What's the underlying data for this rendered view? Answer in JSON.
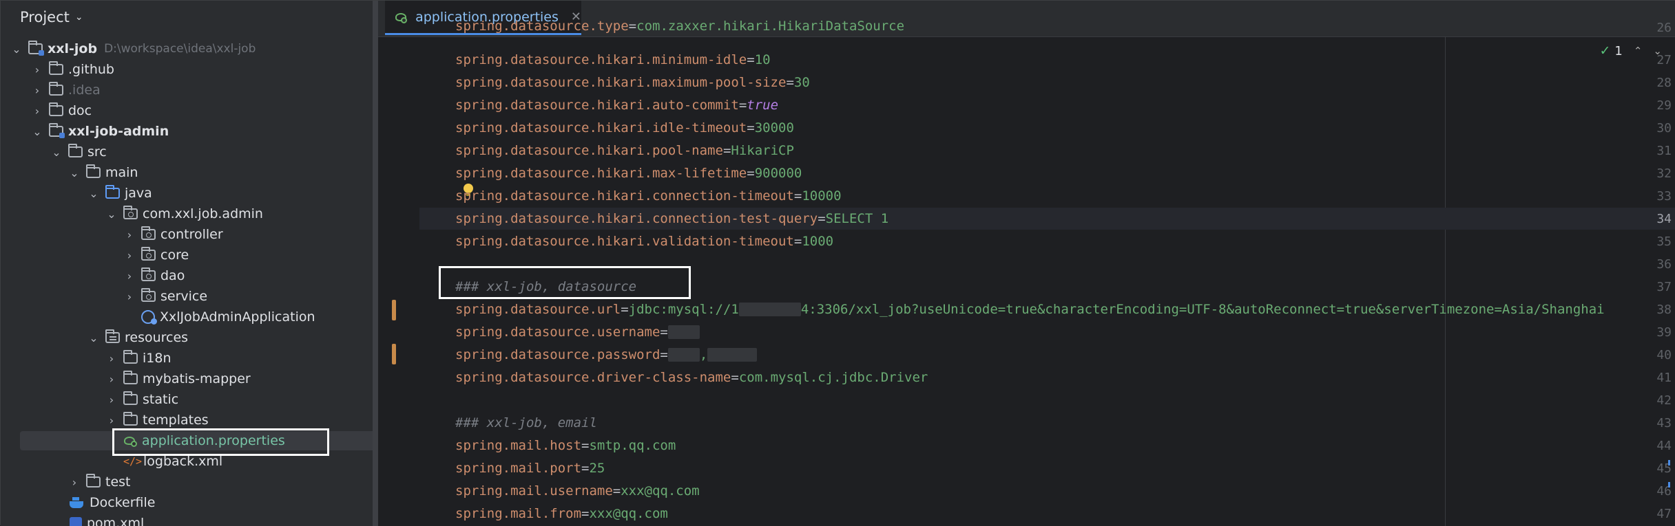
{
  "project_panel": {
    "title": "Project",
    "tree": [
      {
        "label": "xxl-job",
        "hint": "D:\\workspace\\idea\\xxl-job"
      },
      {
        "label": ".github"
      },
      {
        "label": ".idea"
      },
      {
        "label": "doc"
      },
      {
        "label": "xxl-job-admin"
      },
      {
        "label": "src"
      },
      {
        "label": "main"
      },
      {
        "label": "java"
      },
      {
        "label": "com.xxl.job.admin"
      },
      {
        "label": "controller"
      },
      {
        "label": "core"
      },
      {
        "label": "dao"
      },
      {
        "label": "service"
      },
      {
        "label": "XxlJobAdminApplication"
      },
      {
        "label": "resources"
      },
      {
        "label": "i18n"
      },
      {
        "label": "mybatis-mapper"
      },
      {
        "label": "static"
      },
      {
        "label": "templates"
      },
      {
        "label": "application.properties"
      },
      {
        "label": "logback.xml"
      },
      {
        "label": "test"
      },
      {
        "label": "Dockerfile"
      },
      {
        "label": "pom.xml"
      }
    ]
  },
  "editor": {
    "tab_label": "application.properties",
    "inspection_count": "1",
    "lines": [
      {
        "n": "26",
        "key": "spring.datasource.type",
        "eq": "=",
        "val": "com.zaxxer.hikari.HikariDataSource"
      },
      {
        "n": "27",
        "key": "spring.datasource.hikari.minimum-idle",
        "eq": "=",
        "val": "10"
      },
      {
        "n": "28",
        "key": "spring.datasource.hikari.maximum-pool-size",
        "eq": "=",
        "val": "30"
      },
      {
        "n": "29",
        "key": "spring.datasource.hikari.auto-commit",
        "eq": "=",
        "val": "true"
      },
      {
        "n": "30",
        "key": "spring.datasource.hikari.idle-timeout",
        "eq": "=",
        "val": "30000"
      },
      {
        "n": "31",
        "key": "spring.datasource.hikari.pool-name",
        "eq": "=",
        "val": "HikariCP"
      },
      {
        "n": "32",
        "key": "spring.datasource.hikari.max-lifetime",
        "eq": "=",
        "val": "900000"
      },
      {
        "n": "33",
        "key": "spring.datasource.hikari.connection-timeout",
        "eq": "=",
        "val": "10000"
      },
      {
        "n": "34",
        "key": "spring.datasource.hikari.connection-test-query",
        "eq": "=",
        "val": "SELECT 1"
      },
      {
        "n": "35",
        "key": "spring.datasource.hikari.validation-timeout",
        "eq": "=",
        "val": "1000"
      },
      {
        "n": "36"
      },
      {
        "n": "37",
        "comment": "### xxl-job, datasource"
      },
      {
        "n": "38",
        "key": "spring.datasource.url",
        "eq": "=",
        "val_a": "jdbc:mysql://1",
        "val_b": "4:3306/xxl_job?useUnicode=true&characterEncoding=UTF-8&autoReconnect=true&serverTimezone=Asia/Shanghai"
      },
      {
        "n": "39",
        "key": "spring.datasource.username",
        "eq": "="
      },
      {
        "n": "40",
        "key": "spring.datasource.password",
        "eq": "=",
        "val_a": ","
      },
      {
        "n": "41",
        "key": "spring.datasource.driver-class-name",
        "eq": "=",
        "val": "com.mysql.cj.jdbc.Driver"
      },
      {
        "n": "42"
      },
      {
        "n": "43",
        "comment": "### xxl-job, email"
      },
      {
        "n": "44",
        "key": "spring.mail.host",
        "eq": "=",
        "val": "smtp.qq.com"
      },
      {
        "n": "45",
        "key": "spring.mail.port",
        "eq": "=",
        "val": "25"
      },
      {
        "n": "46",
        "key": "spring.mail.username",
        "eq": "=",
        "val": "xxx@qq.com"
      },
      {
        "n": "47",
        "key": "spring.mail.from",
        "eq": "=",
        "val": "xxx@qq.com"
      }
    ]
  }
}
